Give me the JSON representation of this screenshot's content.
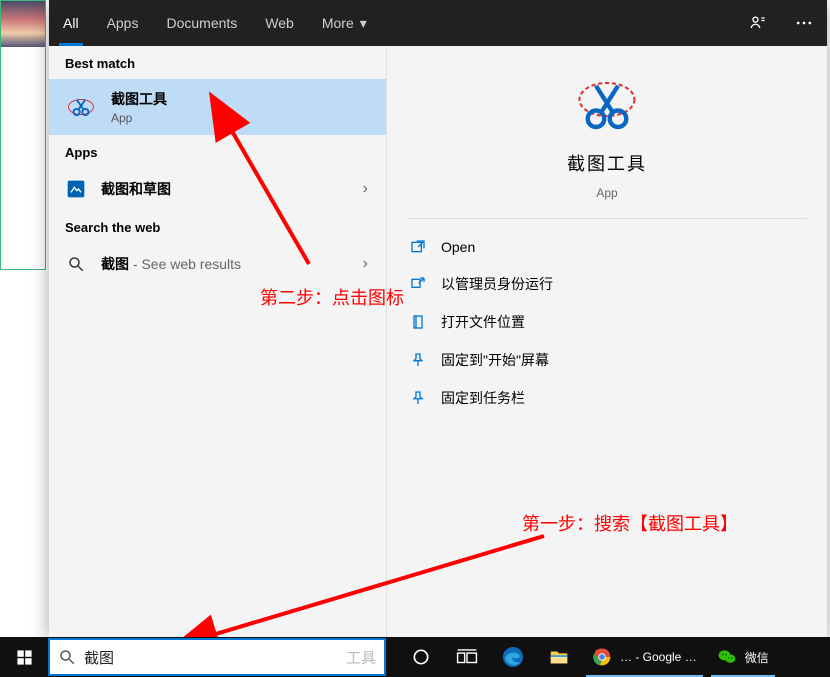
{
  "tabs": {
    "all": "All",
    "apps": "Apps",
    "documents": "Documents",
    "web": "Web",
    "more": "More"
  },
  "sections": {
    "best_match": "Best match",
    "apps": "Apps",
    "search_web": "Search the web"
  },
  "best_match": {
    "title": "截图工具",
    "subtitle": "App"
  },
  "app_result": {
    "title": "截图和草图"
  },
  "web_result": {
    "prefix": "截图",
    "suffix": " - See web results"
  },
  "annotations": {
    "step_two": "第二步：点击图标",
    "step_one": "第一步：搜索【截图工具】"
  },
  "preview": {
    "title": "截图工具",
    "subtitle": "App"
  },
  "actions": {
    "open": "Open",
    "run_admin": "以管理员身份运行",
    "open_loc": "打开文件位置",
    "pin_start": "固定到\"开始\"屏幕",
    "pin_taskbar": "固定到任务栏"
  },
  "search": {
    "value": "截图",
    "placeholder": "工具"
  },
  "taskbar": {
    "chrome_label": "… - Google …",
    "wechat_label": "微信"
  }
}
